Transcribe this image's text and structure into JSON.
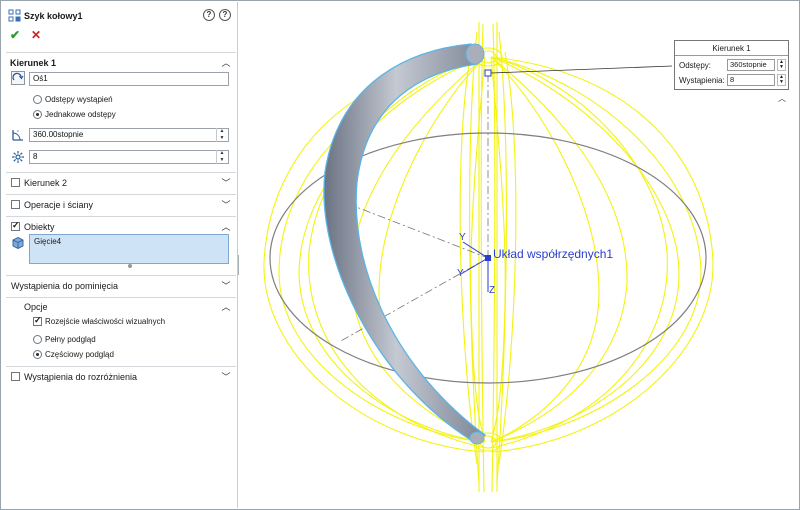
{
  "app": {
    "feature_title": "Szyk kołowy1"
  },
  "direction1": {
    "title": "Kierunek 1",
    "axis_value": "Oś1",
    "spacing_options": [
      "Odstępy wystąpień",
      "Jednakowe odstępy"
    ],
    "selected_spacing": "Jednakowe odstępy",
    "angle_value": "360.00stopnie",
    "instances_value": "8"
  },
  "direction2": {
    "title": "Kierunek 2",
    "checked": false
  },
  "features_faces": {
    "title": "Operacje i ściany"
  },
  "bodies": {
    "title": "Obiekty",
    "checked": true,
    "items": [
      "Gięcie4"
    ]
  },
  "instances_to_skip": {
    "title": "Wystąpienia do pominięcia"
  },
  "options": {
    "title": "Opcje",
    "propagate_visual_label": "Rozejście właściwości wizualnych",
    "propagate_visual_checked": true,
    "preview_options": [
      "Pełny podgląd",
      "Częściowy podgląd"
    ],
    "selected_preview": "Częściowy podgląd"
  },
  "instances_to_vary": {
    "title": "Wystąpienia do rozróżnienia",
    "checked": false
  },
  "viewport": {
    "coord_system_label": "Układ współrzędnych1",
    "axis_labels": [
      "Y",
      "Y",
      "Z"
    ],
    "callout": {
      "title": "Kierunek 1",
      "spacing_label": "Odstępy:",
      "spacing_value": "360stopnie",
      "instances_label": "Wystąpienia:",
      "instances_value": "8"
    }
  },
  "colors": {
    "preview_yellow": "#f3f312",
    "selection_blue": "#5ab4e6",
    "body_gray": "#8f96a3",
    "accent_blue": "#2a3dcc"
  }
}
